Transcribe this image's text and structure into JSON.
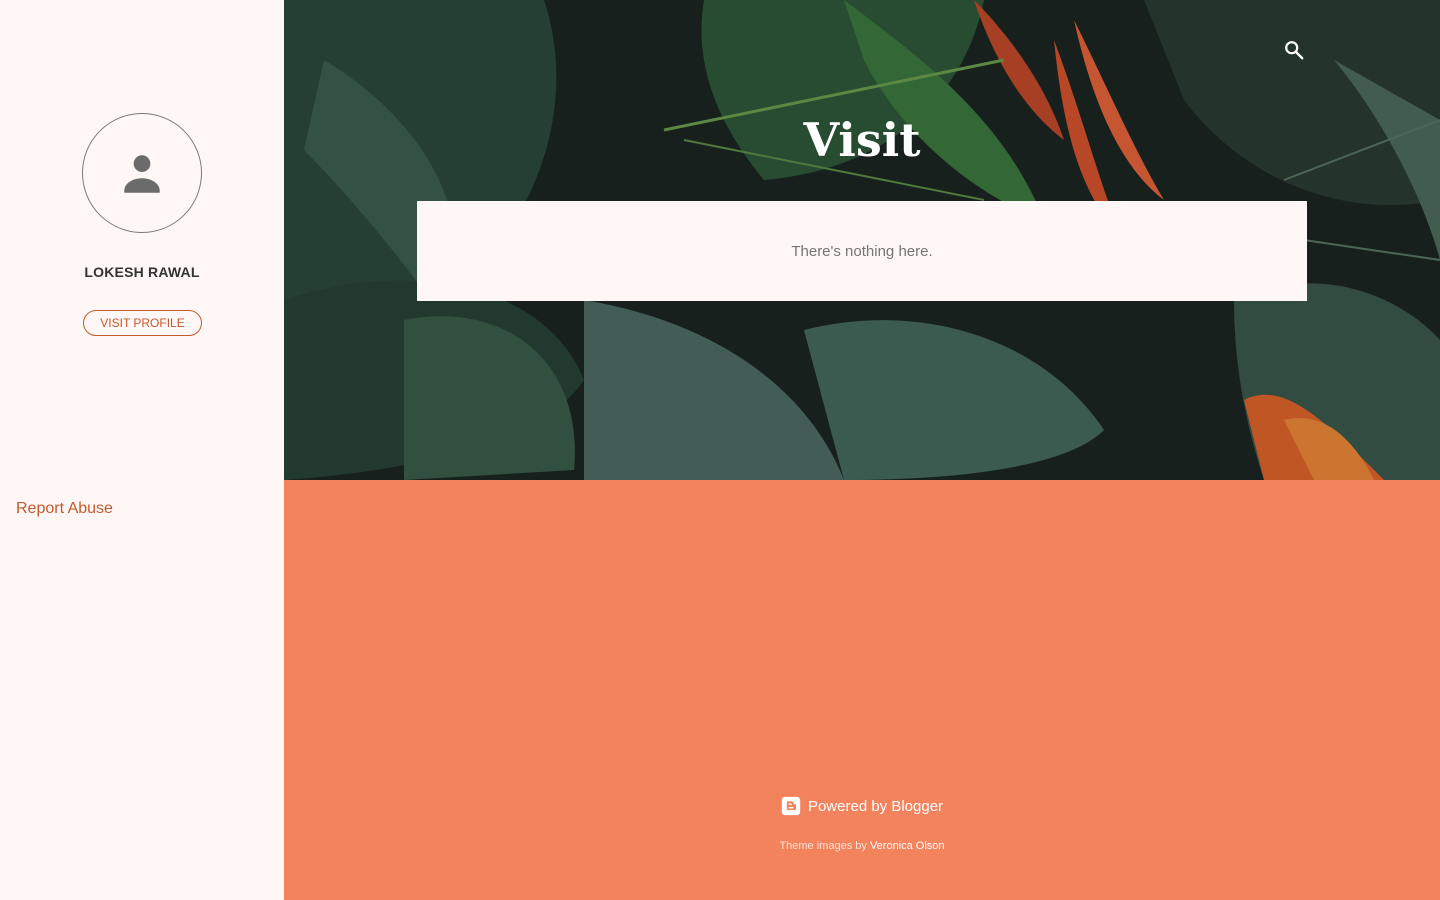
{
  "sidebar": {
    "profile_name": "LOKESH RAWAL",
    "visit_profile_label": "VISIT PROFILE",
    "report_abuse_label": "Report Abuse"
  },
  "header": {
    "title": "Visit",
    "search_icon": "search-icon"
  },
  "main": {
    "empty_message": "There's nothing here."
  },
  "footer": {
    "powered_label": "Powered by Blogger",
    "theme_prefix": "Theme images by",
    "theme_author": "Veronica Olson"
  },
  "colors": {
    "sidebar_bg": "#fff7f5",
    "accent": "#c35a2e",
    "main_bg": "#f2835d",
    "card_bg": "#fff7f5"
  }
}
